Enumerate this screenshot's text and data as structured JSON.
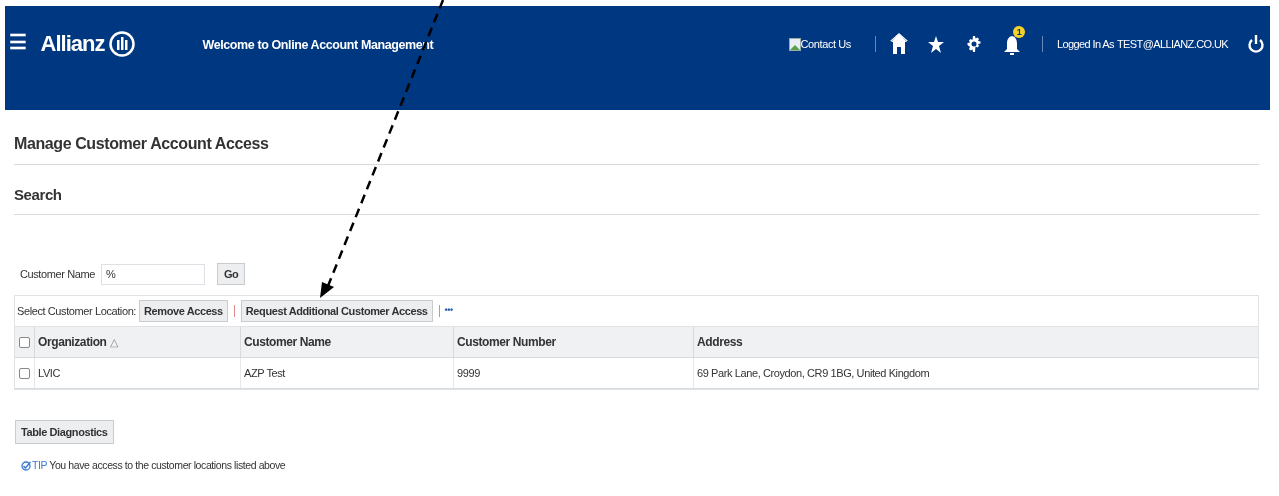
{
  "header": {
    "menu_icon": "☰",
    "logo": "Allianz",
    "title": "Welcome to Online Account Management",
    "contact_link": "Contact Us",
    "notification_count": "1",
    "logged_in_label": "Logged In As",
    "user": "TEST@ALLIANZ.CO.UK"
  },
  "page_title": "Manage Customer Account Access",
  "section_title": "Search",
  "search": {
    "label": "Customer Name",
    "value": "%",
    "button": "Go"
  },
  "toolbar": {
    "label": "Select Customer Location:",
    "buttons": [
      "Remove Access",
      "Request Additional Customer Access"
    ],
    "more": "•••"
  },
  "table": {
    "select_all_checked": false,
    "columns": [
      {
        "label": "Organization",
        "sort_mark": "△"
      },
      {
        "label": "Customer Name"
      },
      {
        "label": "Customer Number"
      },
      {
        "label": "Address"
      }
    ],
    "rows": [
      {
        "checked": false,
        "cells": [
          "LVIC",
          "AZP Test",
          "9999",
          "69 Park Lane, Croydon, CR9 1BG, United Kingdom"
        ]
      }
    ]
  },
  "diagnostics_button": "Table Diagnostics",
  "tip": {
    "label": "TIP",
    "text": "You have access to the customer locations listed above"
  }
}
